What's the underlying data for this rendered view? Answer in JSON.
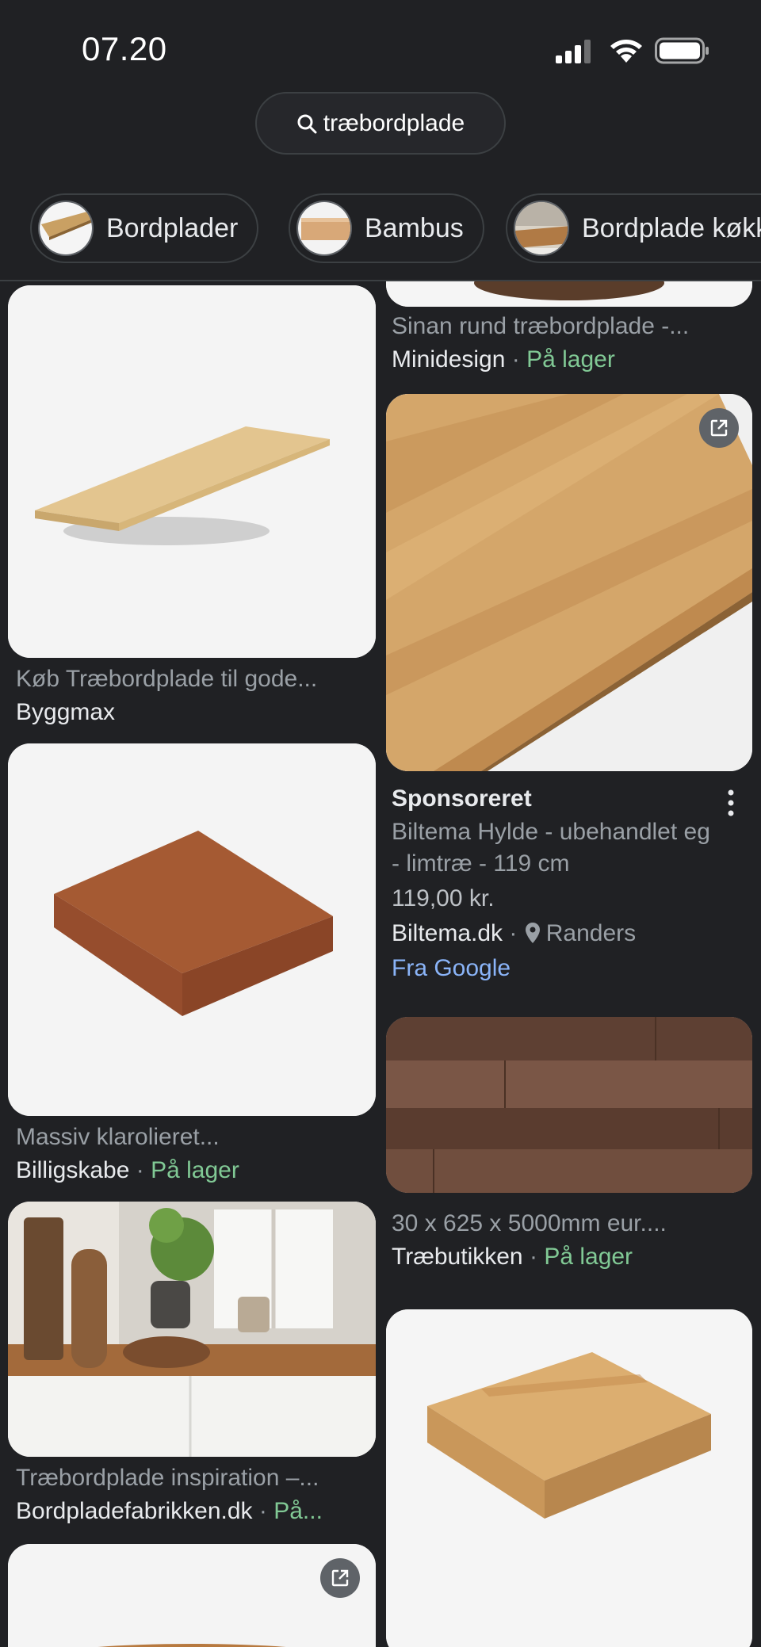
{
  "status_bar": {
    "time": "07.20"
  },
  "search": {
    "query": "træbordplade"
  },
  "chips": [
    {
      "label": "Bordplader"
    },
    {
      "label": "Bambus"
    },
    {
      "label": "Bordplade køkken"
    }
  ],
  "results": {
    "top_right": {
      "title": "Sinan rund træbordplade -...",
      "source": "Minidesign",
      "stock": "På lager",
      "sep": "·"
    },
    "byggmax": {
      "title": "Køb Træbordplade til gode...",
      "source": "Byggmax"
    },
    "sponsored": {
      "label": "Sponsoreret",
      "title_line1": "Biltema Hylde - ubehandlet eg",
      "title_line2": "- limtræ - 119 cm",
      "price": "119,00 kr.",
      "source": "Biltema.dk",
      "sep": "·",
      "location": "Randers",
      "from": "Fra Google"
    },
    "massiv": {
      "title": "Massiv klarolieret...",
      "source": "Billigskabe",
      "stock": "På lager",
      "sep": "·"
    },
    "traebutikken": {
      "title": "30 x 625 x 5000mm eur....",
      "source": "Træbutikken",
      "stock": "På lager",
      "sep": "·"
    },
    "inspiration": {
      "title": "Træbordplade inspiration –...",
      "source": "Bordpladefabrikken.dk",
      "stock": "På...",
      "sep": "·"
    }
  },
  "icons": {
    "search": "search-icon",
    "external": "external-link-icon",
    "more": "more-vert-icon",
    "location": "location-pin-icon"
  }
}
